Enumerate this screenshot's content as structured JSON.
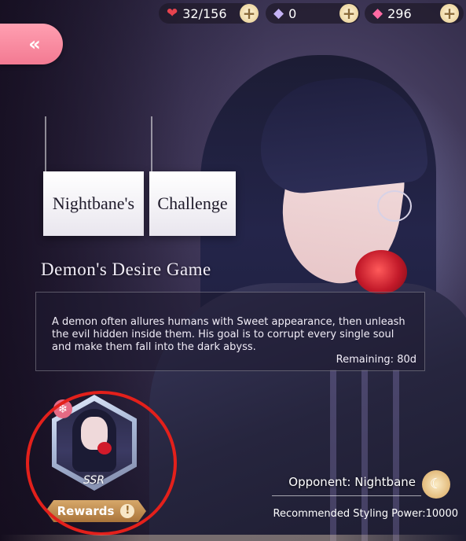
{
  "currencies": [
    {
      "icon": "heart-icon",
      "value": "32/156",
      "color": "#e7434e"
    },
    {
      "icon": "diamond-icon",
      "value": "0",
      "color": "#c5b3f5"
    },
    {
      "icon": "pink-diamond-icon",
      "value": "296",
      "color": "#ff6aa3"
    }
  ],
  "back_label": "«",
  "title": {
    "part1": "Nightbane's",
    "part2": "Challenge"
  },
  "subtitle": "Demon's Desire Game",
  "description": "A demon often allures humans with Sweet appearance, then unleash the evil hidden inside them. His goal is to corrupt every single soul and make them fall into the dark abyss.",
  "remaining": "Remaining: 80d",
  "reward": {
    "rarity": "SSR",
    "button_label": "Rewards",
    "badge": "!"
  },
  "opponent": "Opponent: Nightbane",
  "recommended_power": "Recommended Styling Power:10000",
  "plus_label": "+",
  "snow_glyph": "❄",
  "moon_glyph": "☾"
}
